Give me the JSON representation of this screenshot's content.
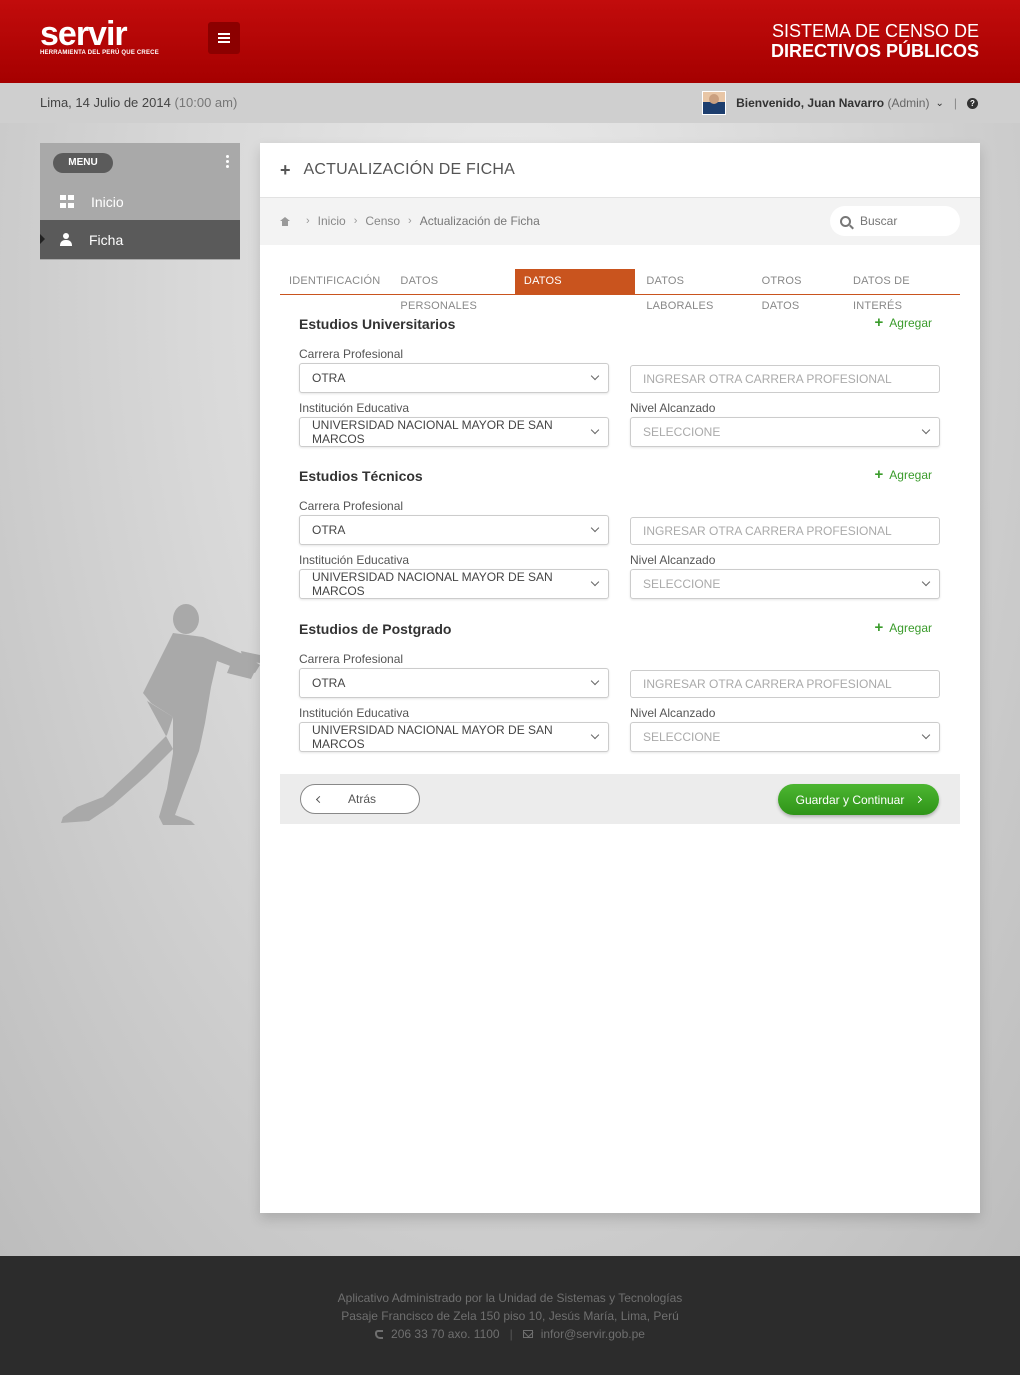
{
  "header": {
    "logo_word": "servir",
    "logo_sub": "HERRAMIENTA DEL PERÚ QUE CRECE",
    "system_title_line1": "SISTEMA DE CENSO  DE",
    "system_title_line2": "DIRECTIVOS PÚBLICOS"
  },
  "subbar": {
    "date": "Lima, 14 Julio de 2014",
    "time": "(10:00 am)",
    "welcome": "Bienvenido, Juan Navarro",
    "role": "(Admin)",
    "separator": "|"
  },
  "sidebar": {
    "menu_label": "MENU",
    "items": [
      {
        "label": "Inicio",
        "icon": "windows-icon"
      },
      {
        "label": "Ficha",
        "icon": "user-icon"
      }
    ]
  },
  "panel": {
    "title": "ACTUALIZACIÓN DE FICHA",
    "breadcrumb": [
      "Inicio",
      "Censo",
      "Actualización de Ficha"
    ],
    "search_placeholder": "Buscar",
    "tabs": [
      "IDENTIFICACIÓN",
      "DATOS PERSONALES",
      "DATOS ACADÉMICOS",
      "DATOS LABORALES",
      "OTROS DATOS",
      "DATOS DE INTERÉS"
    ],
    "active_tab": "DATOS ACADÉMICOS"
  },
  "sections": [
    {
      "title": "Estudios Universitarios",
      "add_label": "Agregar",
      "carrera_label": "Carrera Profesional",
      "carrera_value": "OTRA",
      "otra_placeholder": "INGRESAR OTRA CARRERA PROFESIONAL",
      "institucion_label": "Institución Educativa",
      "institucion_value": "UNIVERSIDAD NACIONAL MAYOR DE SAN MARCOS",
      "nivel_label": "Nivel Alcanzado",
      "nivel_value": "SELECCIONE"
    },
    {
      "title": "Estudios Técnicos",
      "add_label": "Agregar",
      "carrera_label": "Carrera Profesional",
      "carrera_value": "OTRA",
      "otra_placeholder": "INGRESAR OTRA CARRERA PROFESIONAL",
      "institucion_label": "Institución Educativa",
      "institucion_value": "UNIVERSIDAD NACIONAL MAYOR DE SAN MARCOS",
      "nivel_label": "Nivel Alcanzado",
      "nivel_value": "SELECCIONE"
    },
    {
      "title": "Estudios de Postgrado",
      "add_label": "Agregar",
      "carrera_label": "Carrera Profesional",
      "carrera_value": "OTRA",
      "otra_placeholder": "INGRESAR OTRA CARRERA PROFESIONAL",
      "institucion_label": "Institución Educativa",
      "institucion_value": "UNIVERSIDAD NACIONAL MAYOR DE SAN MARCOS",
      "nivel_label": "Nivel Alcanzado",
      "nivel_value": "SELECCIONE"
    }
  ],
  "actions": {
    "back_label": "Atrás",
    "save_label": "Guardar y Continuar"
  },
  "footer": {
    "line1": "Aplicativo Administrado por la Unidad de Sistemas y Tecnologías",
    "line2": "Pasaje Francisco de Zela 150 piso 10, Jesús María, Lima, Perú",
    "phone": "206 33 70 axo. 1100",
    "email": "infor@servir.gob.pe",
    "separator": "|"
  },
  "colors": {
    "brand_red": "#b00000",
    "tab_active": "#c9541e",
    "add_green": "#3a9b2b",
    "save_green": "#3fa524"
  }
}
